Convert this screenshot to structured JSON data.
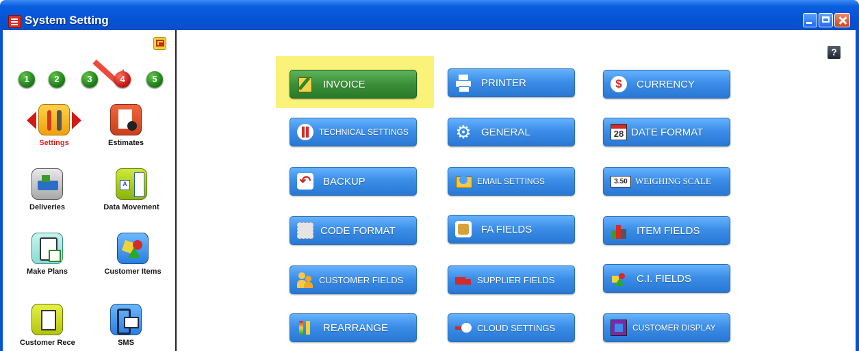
{
  "window": {
    "title": "System Setting"
  },
  "sidebar": {
    "pages": [
      "1",
      "2",
      "3",
      "4",
      "5"
    ],
    "active_page": "4",
    "modules": [
      {
        "label": "Settings",
        "icon": "wrench-screwdriver-icon",
        "active": true
      },
      {
        "label": "Estimates",
        "icon": "document-check-icon"
      },
      {
        "label": "Deliveries",
        "icon": "delivery-truck-icon"
      },
      {
        "label": "Data Movement",
        "icon": "data-transfer-icon"
      },
      {
        "label": "Make Plans",
        "icon": "clipboard-check-icon"
      },
      {
        "label": "Customer Items",
        "icon": "shapes-icon"
      },
      {
        "label": "Customer Rece",
        "icon": "receipt-icon"
      },
      {
        "label": "SMS",
        "icon": "mobile-message-icon"
      }
    ]
  },
  "help": {
    "label": "?"
  },
  "buttons": [
    {
      "label": "INVOICE",
      "icon": "invoice-pen-icon",
      "highlighted": true
    },
    {
      "label": "PRINTER",
      "icon": "printer-icon"
    },
    {
      "label": "CURRENCY",
      "icon": "dollar-icon"
    },
    {
      "label": "TECHNICAL SETTINGS",
      "icon": "tools-icon"
    },
    {
      "label": "GENERAL",
      "icon": "gear-icon"
    },
    {
      "label": "DATE FORMAT",
      "icon": "calendar-icon",
      "icon_text": "28"
    },
    {
      "label": "BACKUP",
      "icon": "undo-arrow-icon"
    },
    {
      "label": "EMAIL SETTINGS",
      "icon": "envelope-icon"
    },
    {
      "label": "WEIGHING SCALE",
      "icon": "scale-display-icon",
      "icon_text": "3.50"
    },
    {
      "label": "CODE FORMAT",
      "icon": "code-grid-icon"
    },
    {
      "label": "FA FIELDS",
      "icon": "database-icon"
    },
    {
      "label": "ITEM FIELDS",
      "icon": "items-icon"
    },
    {
      "label": "CUSTOMER FIELDS",
      "icon": "users-icon"
    },
    {
      "label": "SUPPLIER FIELDS",
      "icon": "truck-icon"
    },
    {
      "label": "C.I. FIELDS",
      "icon": "shapes-icon"
    },
    {
      "label": "REARRANGE",
      "icon": "rearrange-icon"
    },
    {
      "label": "CLOUD SETTINGS",
      "icon": "cloud-arrow-icon"
    },
    {
      "label": "CUSTOMER DISPLAY",
      "icon": "display-square-icon"
    }
  ],
  "colors": {
    "titlebar": "#0553d6",
    "button": "#3c8ee8",
    "active_button": "#3b8f38",
    "highlight": "#fbf27a",
    "page_active": "#c81612",
    "page": "#1b7f14"
  }
}
